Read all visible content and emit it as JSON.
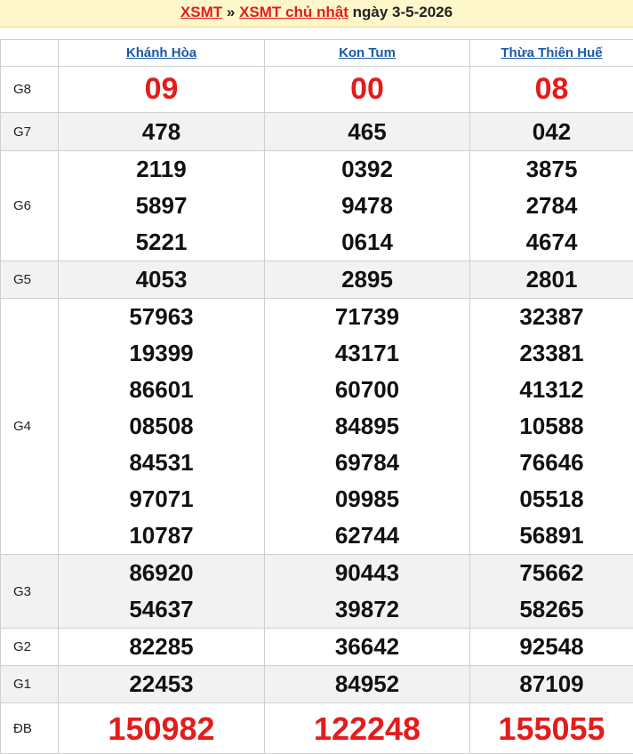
{
  "header": {
    "link1": "XSMT",
    "separator": "»",
    "link2": "XSMT chủ nhật",
    "date_text": "ngày 3-5-2026"
  },
  "provinces": [
    "Khánh Hòa",
    "Kon Tum",
    "Thừa Thiên Huế"
  ],
  "prizes": [
    {
      "label": "G8",
      "values": [
        [
          "09"
        ],
        [
          "00"
        ],
        [
          "08"
        ]
      ]
    },
    {
      "label": "G7",
      "values": [
        [
          "478"
        ],
        [
          "465"
        ],
        [
          "042"
        ]
      ]
    },
    {
      "label": "G6",
      "values": [
        [
          "2119",
          "5897",
          "5221"
        ],
        [
          "0392",
          "9478",
          "0614"
        ],
        [
          "3875",
          "2784",
          "4674"
        ]
      ]
    },
    {
      "label": "G5",
      "values": [
        [
          "4053"
        ],
        [
          "2895"
        ],
        [
          "2801"
        ]
      ]
    },
    {
      "label": "G4",
      "values": [
        [
          "57963",
          "19399",
          "86601",
          "08508",
          "84531",
          "97071",
          "10787"
        ],
        [
          "71739",
          "43171",
          "60700",
          "84895",
          "69784",
          "09985",
          "62744"
        ],
        [
          "32387",
          "23381",
          "41312",
          "10588",
          "76646",
          "05518",
          "56891"
        ]
      ]
    },
    {
      "label": "G3",
      "values": [
        [
          "86920",
          "54637"
        ],
        [
          "90443",
          "39872"
        ],
        [
          "75662",
          "58265"
        ]
      ]
    },
    {
      "label": "G2",
      "values": [
        [
          "82285"
        ],
        [
          "36642"
        ],
        [
          "92548"
        ]
      ]
    },
    {
      "label": "G1",
      "values": [
        [
          "22453"
        ],
        [
          "84952"
        ],
        [
          "87109"
        ]
      ]
    },
    {
      "label": "ĐB",
      "values": [
        [
          "150982"
        ],
        [
          "122248"
        ],
        [
          "155055"
        ]
      ]
    }
  ],
  "colors": {
    "accent_red": "#e31c1c",
    "link_blue": "#1a5aa8",
    "header_bg": "#fff7cc"
  }
}
